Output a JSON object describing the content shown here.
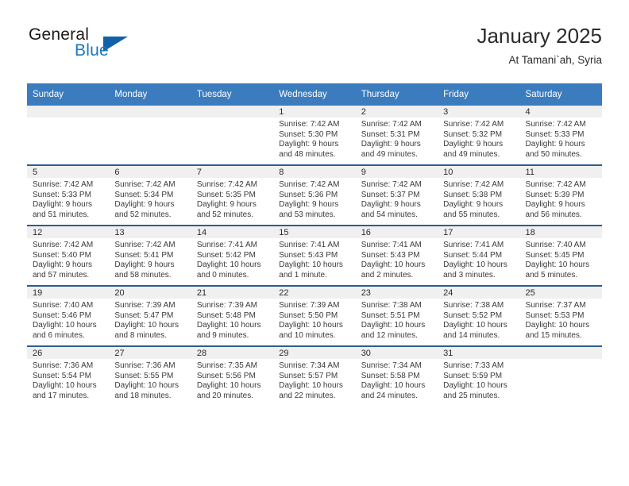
{
  "brand": {
    "line1": "General",
    "line2": "Blue",
    "triangle_color": "#1161a8",
    "blue_color": "#1878be"
  },
  "header": {
    "title": "January 2025",
    "location": "At Tamani`ah, Syria",
    "header_bg": "#3b7cbf",
    "divider_color": "#2f5c8f",
    "datebar_bg": "#f0f0f0"
  },
  "weekdays": [
    "Sunday",
    "Monday",
    "Tuesday",
    "Wednesday",
    "Thursday",
    "Friday",
    "Saturday"
  ],
  "weeks": [
    [
      {
        "empty": true
      },
      {
        "empty": true
      },
      {
        "empty": true
      },
      {
        "day": "1",
        "sunrise": "Sunrise: 7:42 AM",
        "sunset": "Sunset: 5:30 PM",
        "daylight1": "Daylight: 9 hours",
        "daylight2": "and 48 minutes."
      },
      {
        "day": "2",
        "sunrise": "Sunrise: 7:42 AM",
        "sunset": "Sunset: 5:31 PM",
        "daylight1": "Daylight: 9 hours",
        "daylight2": "and 49 minutes."
      },
      {
        "day": "3",
        "sunrise": "Sunrise: 7:42 AM",
        "sunset": "Sunset: 5:32 PM",
        "daylight1": "Daylight: 9 hours",
        "daylight2": "and 49 minutes."
      },
      {
        "day": "4",
        "sunrise": "Sunrise: 7:42 AM",
        "sunset": "Sunset: 5:33 PM",
        "daylight1": "Daylight: 9 hours",
        "daylight2": "and 50 minutes."
      }
    ],
    [
      {
        "day": "5",
        "sunrise": "Sunrise: 7:42 AM",
        "sunset": "Sunset: 5:33 PM",
        "daylight1": "Daylight: 9 hours",
        "daylight2": "and 51 minutes."
      },
      {
        "day": "6",
        "sunrise": "Sunrise: 7:42 AM",
        "sunset": "Sunset: 5:34 PM",
        "daylight1": "Daylight: 9 hours",
        "daylight2": "and 52 minutes."
      },
      {
        "day": "7",
        "sunrise": "Sunrise: 7:42 AM",
        "sunset": "Sunset: 5:35 PM",
        "daylight1": "Daylight: 9 hours",
        "daylight2": "and 52 minutes."
      },
      {
        "day": "8",
        "sunrise": "Sunrise: 7:42 AM",
        "sunset": "Sunset: 5:36 PM",
        "daylight1": "Daylight: 9 hours",
        "daylight2": "and 53 minutes."
      },
      {
        "day": "9",
        "sunrise": "Sunrise: 7:42 AM",
        "sunset": "Sunset: 5:37 PM",
        "daylight1": "Daylight: 9 hours",
        "daylight2": "and 54 minutes."
      },
      {
        "day": "10",
        "sunrise": "Sunrise: 7:42 AM",
        "sunset": "Sunset: 5:38 PM",
        "daylight1": "Daylight: 9 hours",
        "daylight2": "and 55 minutes."
      },
      {
        "day": "11",
        "sunrise": "Sunrise: 7:42 AM",
        "sunset": "Sunset: 5:39 PM",
        "daylight1": "Daylight: 9 hours",
        "daylight2": "and 56 minutes."
      }
    ],
    [
      {
        "day": "12",
        "sunrise": "Sunrise: 7:42 AM",
        "sunset": "Sunset: 5:40 PM",
        "daylight1": "Daylight: 9 hours",
        "daylight2": "and 57 minutes."
      },
      {
        "day": "13",
        "sunrise": "Sunrise: 7:42 AM",
        "sunset": "Sunset: 5:41 PM",
        "daylight1": "Daylight: 9 hours",
        "daylight2": "and 58 minutes."
      },
      {
        "day": "14",
        "sunrise": "Sunrise: 7:41 AM",
        "sunset": "Sunset: 5:42 PM",
        "daylight1": "Daylight: 10 hours",
        "daylight2": "and 0 minutes."
      },
      {
        "day": "15",
        "sunrise": "Sunrise: 7:41 AM",
        "sunset": "Sunset: 5:43 PM",
        "daylight1": "Daylight: 10 hours",
        "daylight2": "and 1 minute."
      },
      {
        "day": "16",
        "sunrise": "Sunrise: 7:41 AM",
        "sunset": "Sunset: 5:43 PM",
        "daylight1": "Daylight: 10 hours",
        "daylight2": "and 2 minutes."
      },
      {
        "day": "17",
        "sunrise": "Sunrise: 7:41 AM",
        "sunset": "Sunset: 5:44 PM",
        "daylight1": "Daylight: 10 hours",
        "daylight2": "and 3 minutes."
      },
      {
        "day": "18",
        "sunrise": "Sunrise: 7:40 AM",
        "sunset": "Sunset: 5:45 PM",
        "daylight1": "Daylight: 10 hours",
        "daylight2": "and 5 minutes."
      }
    ],
    [
      {
        "day": "19",
        "sunrise": "Sunrise: 7:40 AM",
        "sunset": "Sunset: 5:46 PM",
        "daylight1": "Daylight: 10 hours",
        "daylight2": "and 6 minutes."
      },
      {
        "day": "20",
        "sunrise": "Sunrise: 7:39 AM",
        "sunset": "Sunset: 5:47 PM",
        "daylight1": "Daylight: 10 hours",
        "daylight2": "and 8 minutes."
      },
      {
        "day": "21",
        "sunrise": "Sunrise: 7:39 AM",
        "sunset": "Sunset: 5:48 PM",
        "daylight1": "Daylight: 10 hours",
        "daylight2": "and 9 minutes."
      },
      {
        "day": "22",
        "sunrise": "Sunrise: 7:39 AM",
        "sunset": "Sunset: 5:50 PM",
        "daylight1": "Daylight: 10 hours",
        "daylight2": "and 10 minutes."
      },
      {
        "day": "23",
        "sunrise": "Sunrise: 7:38 AM",
        "sunset": "Sunset: 5:51 PM",
        "daylight1": "Daylight: 10 hours",
        "daylight2": "and 12 minutes."
      },
      {
        "day": "24",
        "sunrise": "Sunrise: 7:38 AM",
        "sunset": "Sunset: 5:52 PM",
        "daylight1": "Daylight: 10 hours",
        "daylight2": "and 14 minutes."
      },
      {
        "day": "25",
        "sunrise": "Sunrise: 7:37 AM",
        "sunset": "Sunset: 5:53 PM",
        "daylight1": "Daylight: 10 hours",
        "daylight2": "and 15 minutes."
      }
    ],
    [
      {
        "day": "26",
        "sunrise": "Sunrise: 7:36 AM",
        "sunset": "Sunset: 5:54 PM",
        "daylight1": "Daylight: 10 hours",
        "daylight2": "and 17 minutes."
      },
      {
        "day": "27",
        "sunrise": "Sunrise: 7:36 AM",
        "sunset": "Sunset: 5:55 PM",
        "daylight1": "Daylight: 10 hours",
        "daylight2": "and 18 minutes."
      },
      {
        "day": "28",
        "sunrise": "Sunrise: 7:35 AM",
        "sunset": "Sunset: 5:56 PM",
        "daylight1": "Daylight: 10 hours",
        "daylight2": "and 20 minutes."
      },
      {
        "day": "29",
        "sunrise": "Sunrise: 7:34 AM",
        "sunset": "Sunset: 5:57 PM",
        "daylight1": "Daylight: 10 hours",
        "daylight2": "and 22 minutes."
      },
      {
        "day": "30",
        "sunrise": "Sunrise: 7:34 AM",
        "sunset": "Sunset: 5:58 PM",
        "daylight1": "Daylight: 10 hours",
        "daylight2": "and 24 minutes."
      },
      {
        "day": "31",
        "sunrise": "Sunrise: 7:33 AM",
        "sunset": "Sunset: 5:59 PM",
        "daylight1": "Daylight: 10 hours",
        "daylight2": "and 25 minutes."
      },
      {
        "empty": true
      }
    ]
  ]
}
